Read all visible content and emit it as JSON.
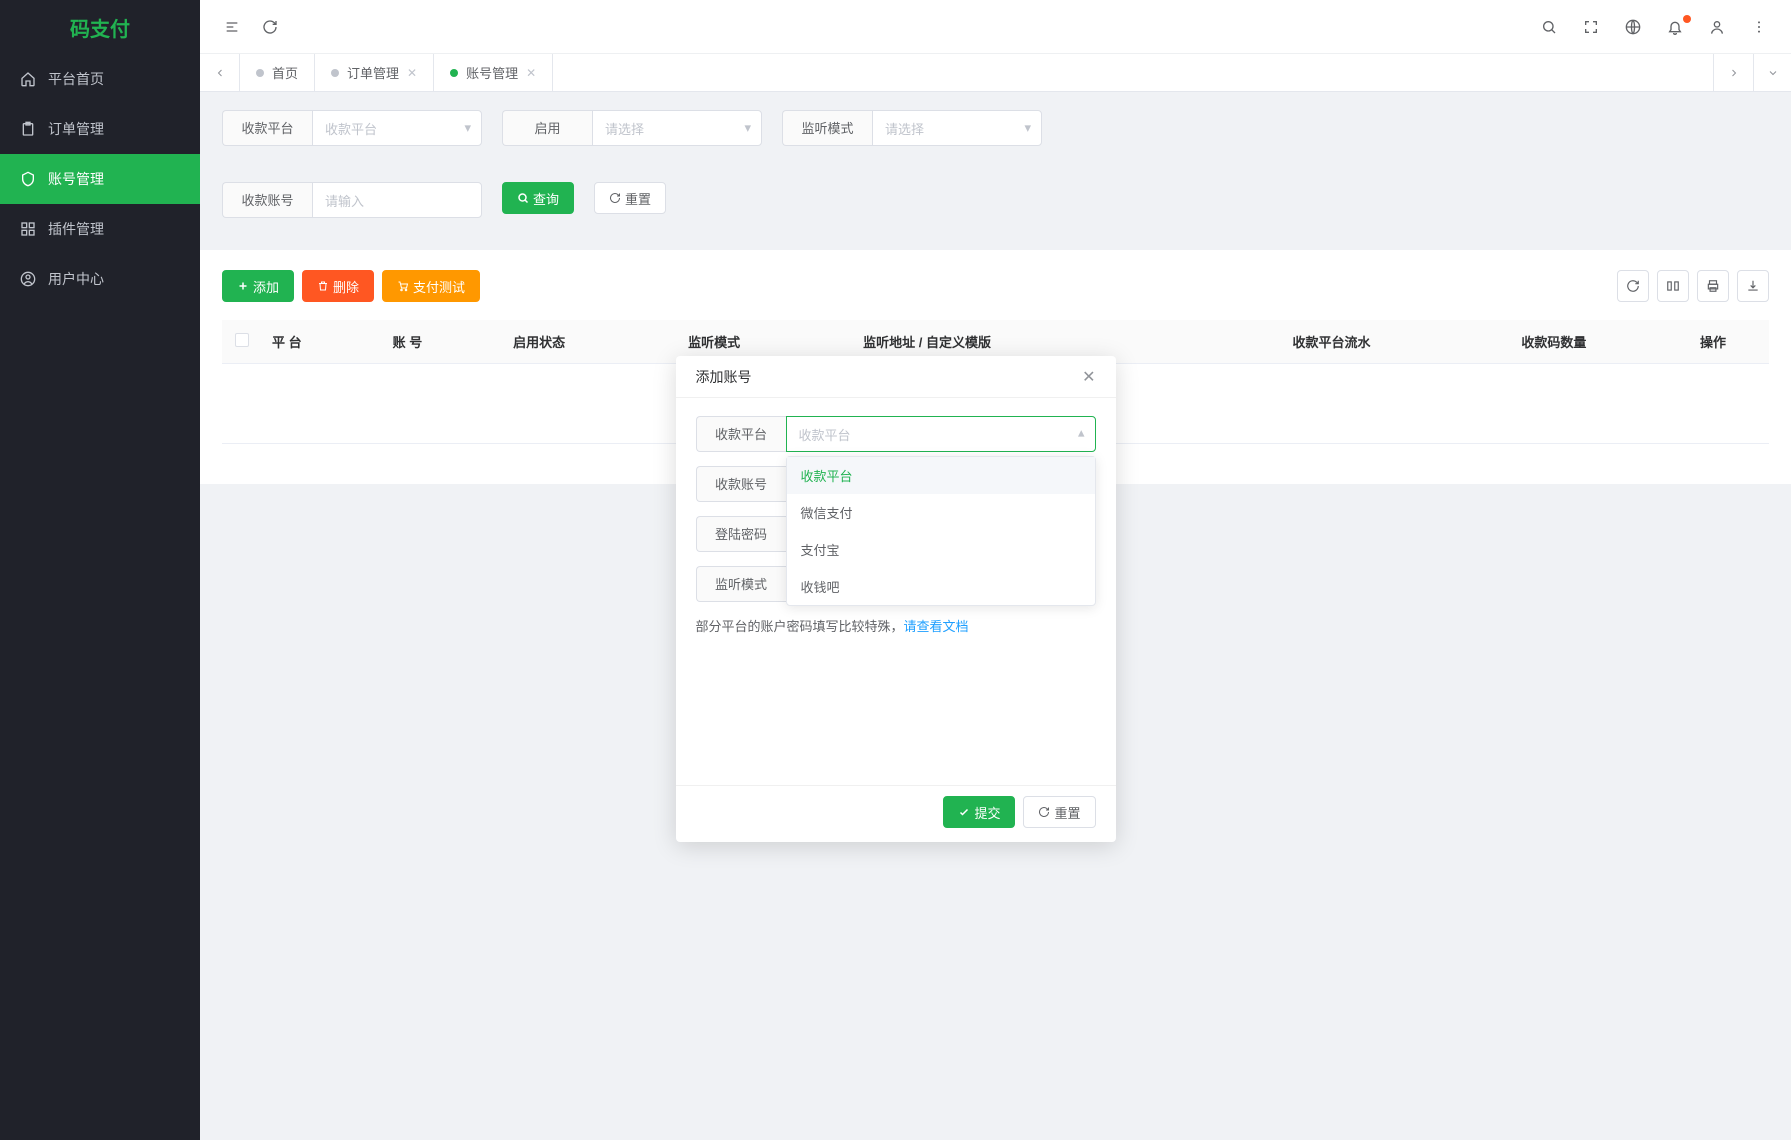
{
  "app_name": "码支付",
  "sidebar": {
    "items": [
      {
        "label": "平台首页"
      },
      {
        "label": "订单管理"
      },
      {
        "label": "账号管理"
      },
      {
        "label": "插件管理"
      },
      {
        "label": "用户中心"
      }
    ]
  },
  "tabs": [
    {
      "label": "首页",
      "closable": false,
      "active": false
    },
    {
      "label": "订单管理",
      "closable": true,
      "active": false
    },
    {
      "label": "账号管理",
      "closable": true,
      "active": true
    }
  ],
  "filters": {
    "platform": {
      "label": "收款平台",
      "placeholder": "收款平台"
    },
    "enabled": {
      "label": "启用",
      "placeholder": "请选择"
    },
    "monitor_mode": {
      "label": "监听模式",
      "placeholder": "请选择"
    },
    "account": {
      "label": "收款账号",
      "placeholder": "请输入"
    },
    "search_btn": "查询",
    "reset_btn": "重置"
  },
  "table": {
    "add_btn": "添加",
    "delete_btn": "删除",
    "test_btn": "支付测试",
    "columns": [
      "平 台",
      "账 号",
      "启用状态",
      "监听模式",
      "监听地址 / 自定义模版",
      "收款平台流水",
      "收款码数量",
      "操作"
    ]
  },
  "modal": {
    "title": "添加账号",
    "fields": {
      "platform": {
        "label": "收款平台",
        "placeholder": "收款平台"
      },
      "account": {
        "label": "收款账号"
      },
      "password": {
        "label": "登陆密码"
      },
      "monitor_mode": {
        "label": "监听模式"
      }
    },
    "dropdown_options": [
      "收款平台",
      "微信支付",
      "支付宝",
      "收钱吧"
    ],
    "note_prefix": "部分平台的账户密码填写比较特殊，",
    "note_link": "请查看文档",
    "submit_btn": "提交",
    "reset_btn": "重置"
  }
}
